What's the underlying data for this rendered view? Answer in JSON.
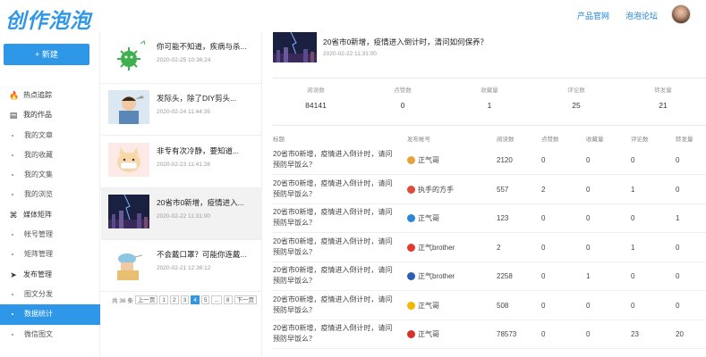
{
  "header": {
    "logo": "创作泡泡",
    "links": [
      "产品官网",
      "泡泡论坛"
    ]
  },
  "sidebar": {
    "new_button": "+ 新建",
    "items": [
      {
        "label": "热点追踪",
        "type": "top",
        "icon": "fire-icon",
        "glyph": "🔥"
      },
      {
        "label": "我的作品",
        "type": "top",
        "icon": "document-icon",
        "glyph": "▤"
      },
      {
        "label": "我的文章",
        "type": "sub"
      },
      {
        "label": "我的收藏",
        "type": "sub"
      },
      {
        "label": "我的文集",
        "type": "sub"
      },
      {
        "label": "我的浏览",
        "type": "sub"
      },
      {
        "label": "媒体矩阵",
        "type": "top",
        "icon": "matrix-icon",
        "glyph": "⌘"
      },
      {
        "label": "帐号管理",
        "type": "sub"
      },
      {
        "label": "矩阵管理",
        "type": "sub"
      },
      {
        "label": "发布管理",
        "type": "top",
        "icon": "send-icon",
        "glyph": "➤"
      },
      {
        "label": "图文分发",
        "type": "sub"
      },
      {
        "label": "数据统计",
        "type": "sub",
        "active": true
      },
      {
        "label": "微信图文",
        "type": "sub"
      }
    ]
  },
  "articles": [
    {
      "title": "你可能不知道，疾病与杀...",
      "date": "2020-02-25 10:36:24",
      "thumb": "virus"
    },
    {
      "title": "发际头，除了DIY剪头...",
      "date": "2020-02-24 11:44:35",
      "thumb": "haircut"
    },
    {
      "title": "非专有次冷静，要知道...",
      "date": "2020-02-23 11:41:28",
      "thumb": "cat"
    },
    {
      "title": "20省市0新增，疫情进入...",
      "date": "2020-02-22 11:31:00",
      "thumb": "city",
      "selected": true
    },
    {
      "title": "不会戴口罩？可能你连戴...",
      "date": "2020-02-21 12:36:12",
      "thumb": "mask"
    }
  ],
  "pager": {
    "total": "共 36 条",
    "prev": "上一页",
    "pages": [
      "1",
      "2",
      "3",
      "4",
      "5",
      "...",
      "8"
    ],
    "current": "4",
    "next": "下一页"
  },
  "detail": {
    "title": "20省市0新增，疫情进入倒计时，清问如何保养？",
    "date": "2020-02-22 11:31:00",
    "stats": [
      {
        "label": "阅读数",
        "value": "84141"
      },
      {
        "label": "点赞数",
        "value": "0"
      },
      {
        "label": "收藏量",
        "value": "1"
      },
      {
        "label": "评论数",
        "value": "25"
      },
      {
        "label": "转发量",
        "value": "21"
      }
    ],
    "columns": [
      "标题",
      "发布帐号",
      "阅读数",
      "点赞数",
      "收藏量",
      "评论数",
      "转发量"
    ],
    "rows": [
      {
        "title": "20省市0新增，疫情进入倒计时，请问预防早饭么？",
        "author": "正气哥",
        "icon_color": "#e8a23a",
        "read": "2120",
        "like": "0",
        "fav": "0",
        "comment": "0",
        "share": "0"
      },
      {
        "title": "20省市0新增，疫情进入倒计时，请问预防早饭么？",
        "author": "执手的方手",
        "icon_color": "#e04a3c",
        "read": "557",
        "like": "2",
        "fav": "0",
        "comment": "1",
        "share": "0"
      },
      {
        "title": "20省市0新增，疫情进入倒计时，请问预防早饭么？",
        "author": "正气哥",
        "icon_color": "#2a86d6",
        "read": "123",
        "like": "0",
        "fav": "0",
        "comment": "0",
        "share": "1"
      },
      {
        "title": "20省市0新增，疫情进入倒计时，请问预防早饭么？",
        "author": "正气brother",
        "icon_color": "#e23b2e",
        "read": "2",
        "like": "0",
        "fav": "0",
        "comment": "1",
        "share": "0"
      },
      {
        "title": "20省市0新增，疫情进入倒计时，请问预防早饭么？",
        "author": "正气brother",
        "icon_color": "#2a5fb8",
        "read": "2258",
        "like": "0",
        "fav": "1",
        "comment": "0",
        "share": "0"
      },
      {
        "title": "20省市0新增，疫情进入倒计时，请问预防早饭么？",
        "author": "正气哥",
        "icon_color": "#f0b800",
        "read": "508",
        "like": "0",
        "fav": "0",
        "comment": "0",
        "share": "0"
      },
      {
        "title": "20省市0新增，疫情进入倒计时，请问预防早饭么？",
        "author": "正气哥",
        "icon_color": "#d9302a",
        "read": "78573",
        "like": "0",
        "fav": "0",
        "comment": "23",
        "share": "20"
      }
    ]
  }
}
